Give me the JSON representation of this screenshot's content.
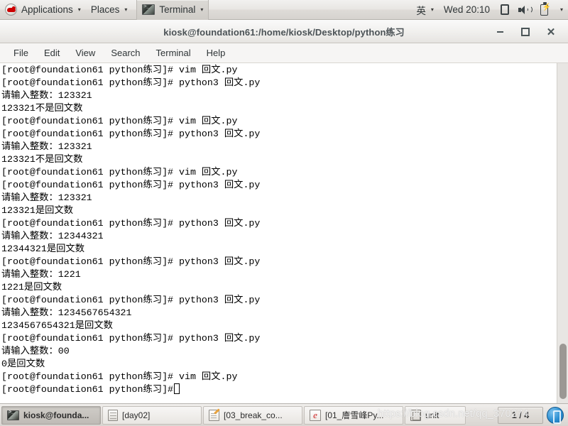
{
  "top_panel": {
    "logo_icon": "redhat-logo-icon",
    "applications_label": "Applications",
    "places_label": "Places",
    "window_button_label": "Terminal",
    "window_button_icon": "terminal-icon",
    "caret": "▾",
    "input_method_label": "英",
    "clock_label": "Wed 20:10",
    "tray_icons": [
      "display-icon",
      "volume-icon",
      "battery-icon"
    ],
    "tray_caret": "▾"
  },
  "window": {
    "title": "kiosk@foundation61:/home/kiosk/Desktop/python练习",
    "controls": {
      "minimize": "minimize-button",
      "maximize": "maximize-button",
      "close": "✕"
    },
    "menu": [
      "File",
      "Edit",
      "View",
      "Search",
      "Terminal",
      "Help"
    ]
  },
  "terminal": {
    "prompt": "[root@foundation61 python练习]# ",
    "lines": [
      "[root@foundation61 python练习]# vim 回文.py",
      "[root@foundation61 python练习]# python3 回文.py",
      "请输入整数：123321",
      "123321不是回文数",
      "[root@foundation61 python练习]# vim 回文.py",
      "[root@foundation61 python练习]# python3 回文.py",
      "请输入整数：123321",
      "123321不是回文数",
      "[root@foundation61 python练习]# vim 回文.py",
      "[root@foundation61 python练习]# python3 回文.py",
      "请输入整数：123321",
      "123321是回文数",
      "[root@foundation61 python练习]# python3 回文.py",
      "请输入整数：12344321",
      "12344321是回文数",
      "[root@foundation61 python练习]# python3 回文.py",
      "请输入整数：1221",
      "1221是回文数",
      "[root@foundation61 python练习]# python3 回文.py",
      "请输入整数：1234567654321",
      "1234567654321是回文数",
      "[root@foundation61 python练习]# python3 回文.py",
      "请输入整数：00",
      "0是回文数",
      "[root@foundation61 python练习]# vim 回文.py"
    ],
    "last_line": "[root@foundation61 python练习]#",
    "background_color": "#ffffff",
    "text_color": "#000000"
  },
  "taskbar": {
    "items": [
      {
        "label": "kiosk@founda...",
        "icon": "terminal-icon",
        "active": true
      },
      {
        "label": "[day02]",
        "icon": "file-manager-icon",
        "active": false
      },
      {
        "label": "[03_break_co...",
        "icon": "text-editor-icon",
        "active": false
      },
      {
        "label": "[01_廥雪峰Py...",
        "icon": "browser-icon",
        "active": false
      },
      {
        "label": "unit",
        "icon": "archive-icon",
        "active": false
      }
    ],
    "workspace_indicator": "1 / 4",
    "trash_icon": "trash-icon"
  },
  "watermark": {
    "text": "https://blog.csdn.net/qq_370274"
  }
}
